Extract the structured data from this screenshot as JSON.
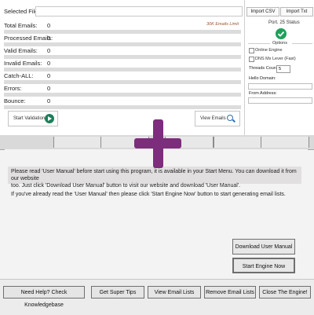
{
  "top": {
    "selected_file_label": "Selected File:",
    "total_emails_label": "Total Emails:",
    "total_emails_value": "0",
    "limit_note": "30K Emails Limit",
    "processed_emails_label": "Processed Emails:",
    "processed_emails_value": "0",
    "valid_emails_label": "Valid Emails:",
    "valid_emails_value": "0",
    "invalid_emails_label": "Invalid Emails:",
    "invalid_emails_value": "0",
    "catch_all_label": "Catch-ALL:",
    "catch_all_value": "0",
    "errors_label": "Errors:",
    "errors_value": "0",
    "bounce_label": "Bounce:",
    "bounce_value": "0",
    "start_validation_label": "Start Validation",
    "view_emails_label": "View Emails",
    "import_csv_label": "Import CSV",
    "import_txt_label": "Import Txt",
    "port_status_label": "Port. 25 Status",
    "options_label": "Options",
    "online_engine_label": "Online Engine",
    "dns_mx_label": "DNS Mx Lever (Fast)",
    "threads_count_label": "Threads Count:",
    "threads_count_value": "5",
    "helo_domain_label": "Hello Domain:",
    "from_address_label": "From Address:"
  },
  "overlay": {
    "plus_color": "#7c2d7c"
  },
  "main": {
    "message_line_1": "Please read 'User Manual' before start using this program, it is available in your Start Menu. You can download it from our website",
    "message_line_2": "too. Just click 'Download User Manual' button to visit our website and download 'User Manual'.",
    "message_line_3": "If you've already read the 'User Manual' then please click 'Start Engine Now' button to start generating email lists.",
    "download_manual_label": "Download User Manual",
    "start_engine_label": "Start Engine Now"
  },
  "footer": {
    "help_label": "Need Help? Check Knowledgebase",
    "super_tips_label": "Get Super Tips",
    "view_lists_label": "View Email Lists",
    "remove_lists_label": "Remove Email Lists",
    "close_label": "Close The Engine!"
  },
  "colors": {
    "check_green": "#1fa05a",
    "play_green": "#1b7f5a",
    "search_blue": "#2e6fb8",
    "limit_text": "#a0522d"
  }
}
